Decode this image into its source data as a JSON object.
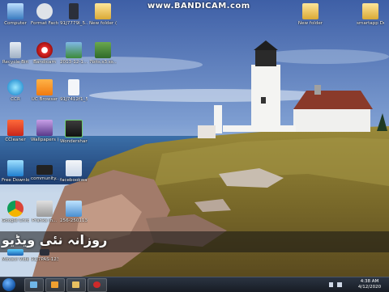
{
  "watermark": "www.BANDICAM.com",
  "banner_text": "روزانہ نئی ویڈیو",
  "desktop_icons": [
    {
      "label": "Computer",
      "icon": "computer-icon"
    },
    {
      "label": "Format Factory",
      "icon": "format-factory-icon"
    },
    {
      "label": "91J7779I_5...",
      "icon": "phone-file-icon"
    },
    {
      "label": "New folder (2)",
      "icon": "folder-icon"
    },
    {
      "label": "New folder",
      "icon": "folder-icon"
    },
    {
      "label": "smartapp Design",
      "icon": "folder-icon"
    },
    {
      "label": "Recycle Bin",
      "icon": "recycle-bin-icon"
    },
    {
      "label": "Bandicam",
      "icon": "bandicam-icon"
    },
    {
      "label": "2013-12-1...",
      "icon": "image-file-icon"
    },
    {
      "label": "7bits.s3.ss...",
      "icon": "image-file-icon"
    },
    {
      "label": "CCR",
      "icon": "ccr-icon"
    },
    {
      "label": "UC Browser",
      "icon": "uc-browser-icon"
    },
    {
      "label": "91J7412f1_5...",
      "icon": "document-file-icon"
    },
    {
      "label": "CCleaner",
      "icon": "ccleaner-icon"
    },
    {
      "label": "Wallpapers (331)",
      "icon": "wallpapers-icon"
    },
    {
      "label": "Wondershare MirrorGo",
      "icon": "mirrorgo-icon"
    },
    {
      "label": "Free Downloa...",
      "icon": "free-download-icon"
    },
    {
      "label": "community...",
      "icon": "community-file-icon"
    },
    {
      "label": "facebookwa...",
      "icon": "facebook-file-icon"
    },
    {
      "label": "Google Chrome",
      "icon": "chrome-icon"
    },
    {
      "label": "Pranks in...",
      "icon": "pranks-file-icon"
    },
    {
      "label": "256-2501132...",
      "icon": "media-file-icon"
    },
    {
      "label": "Movavi Video Editor 14",
      "icon": "movavi-icon"
    },
    {
      "label": "91J7PAS-123...",
      "icon": "phone-file-icon"
    }
  ],
  "taskbar": {
    "buttons": [
      "explorer-icon",
      "media-player-icon",
      "folder-icon",
      "bandicam-icon"
    ],
    "time": "4:38 AM",
    "date": "4/12/2020"
  }
}
